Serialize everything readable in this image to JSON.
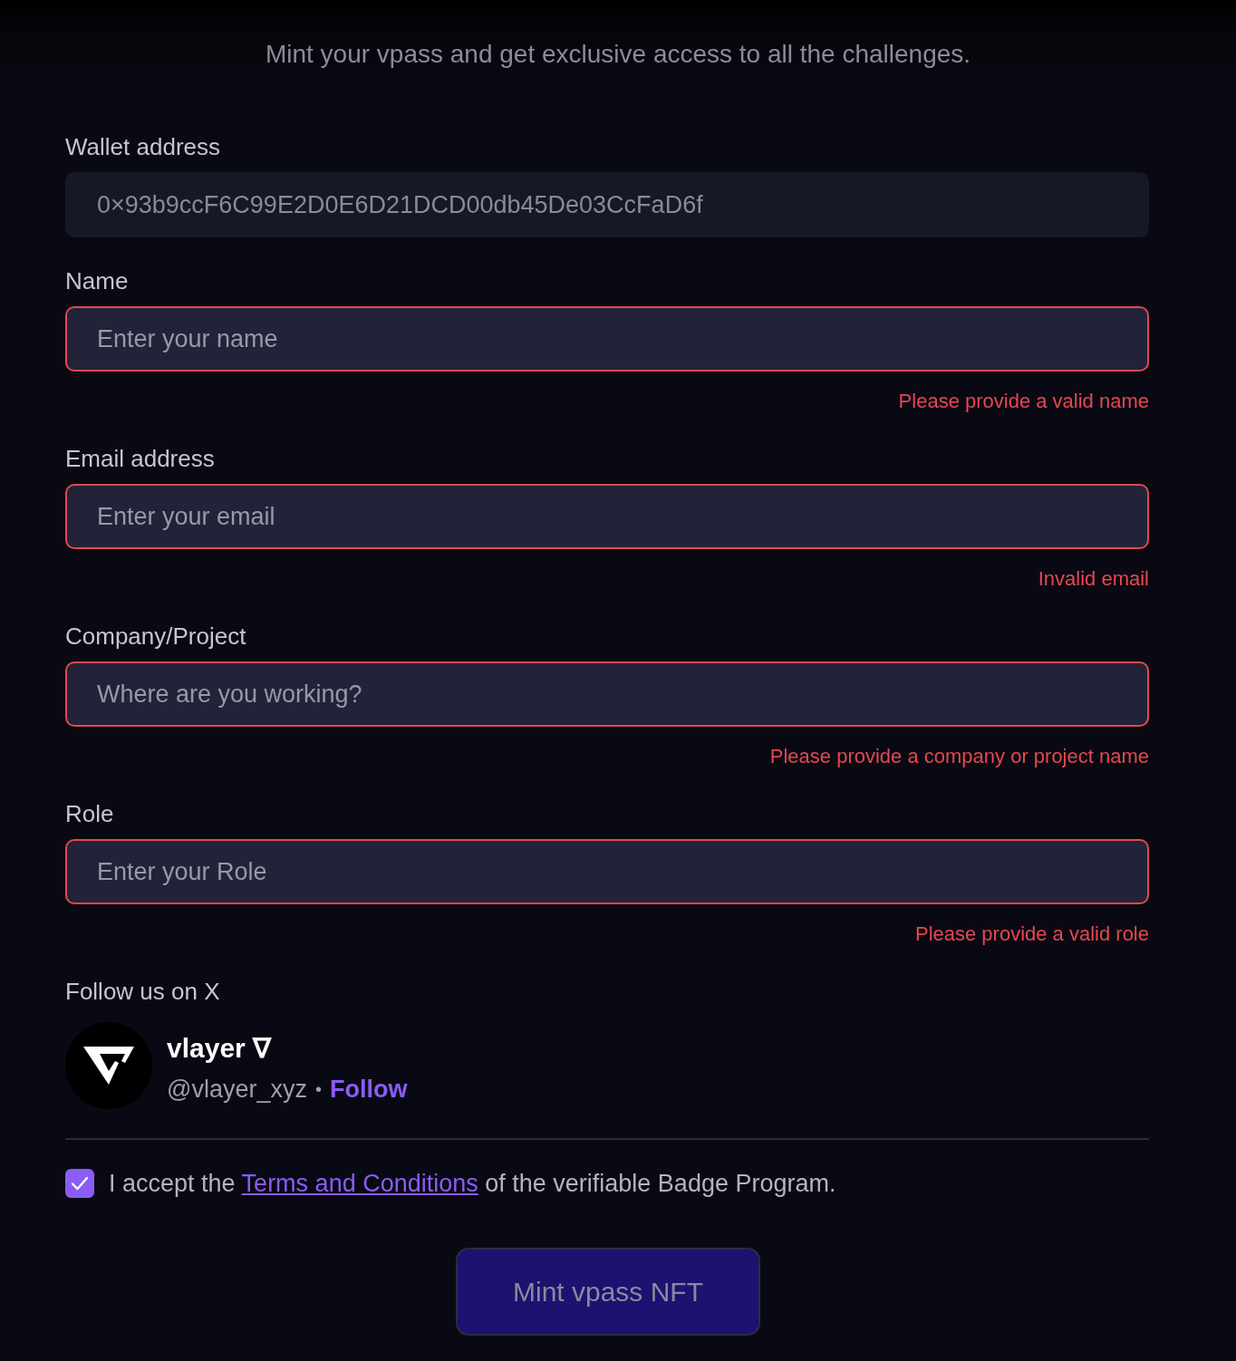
{
  "subtitle": "Mint your vpass and get exclusive access to all the challenges.",
  "fields": [
    {
      "kind": "readonly",
      "label": "Wallet address",
      "value": "0×93b9ccF6C99E2D0E6D21DCD00db45De03CcFaD6f",
      "invalid": false
    },
    {
      "kind": "text",
      "label": "Name",
      "placeholder": "Enter your name",
      "invalid": true,
      "error": "Please provide a valid name"
    },
    {
      "kind": "text",
      "label": "Email address",
      "placeholder": "Enter your email",
      "invalid": true,
      "error": "Invalid email"
    },
    {
      "kind": "text",
      "label": "Company/Project",
      "placeholder": "Where are you working?",
      "invalid": true,
      "error": "Please provide a company or project name"
    },
    {
      "kind": "text",
      "label": "Role",
      "placeholder": "Enter your Role",
      "invalid": true,
      "error": "Please provide a valid role"
    }
  ],
  "follow": {
    "label": "Follow us on X",
    "account_name": "vlayer ∇",
    "handle": "@vlayer_xyz",
    "separator": "•",
    "follow_link": "Follow"
  },
  "consent": {
    "checked": true,
    "text_before": "I accept the",
    "link": "Terms and Conditions",
    "text_after": "of the verifiable Badge Program."
  },
  "submit": {
    "label": "Mint vpass NFT",
    "disabled": true
  }
}
